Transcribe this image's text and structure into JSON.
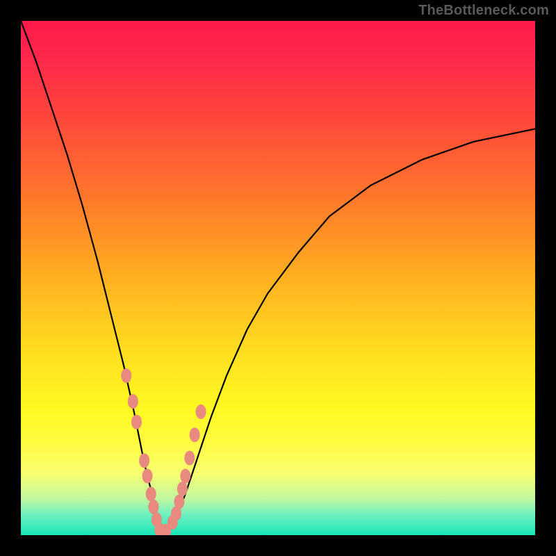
{
  "watermark": {
    "text": "TheBottleneck.com"
  },
  "chart_data": {
    "type": "line",
    "title": "",
    "xlabel": "",
    "ylabel": "",
    "xlim": [
      0,
      100
    ],
    "ylim": [
      0,
      100
    ],
    "grid": false,
    "legend": false,
    "background": {
      "gradient_stops": [
        {
          "pos": 0,
          "color": "#ff1a4d"
        },
        {
          "pos": 0.5,
          "color": "#ffe020"
        },
        {
          "pos": 1,
          "color": "#18e5b8"
        }
      ]
    },
    "series": [
      {
        "name": "bottleneck-curve",
        "color": "#000000",
        "x": [
          0,
          3,
          6,
          9,
          12,
          15,
          18,
          20,
          22,
          24,
          26,
          27,
          28,
          30,
          32,
          34,
          37,
          40,
          44,
          48,
          54,
          60,
          68,
          78,
          88,
          100
        ],
        "y": [
          100,
          92,
          83,
          74,
          64,
          53,
          41,
          33,
          24,
          14,
          6,
          1,
          0.3,
          3,
          8,
          14,
          23,
          31,
          40,
          47,
          55,
          62,
          68,
          73,
          76.5,
          79
        ]
      }
    ],
    "markers": [
      {
        "name": "left-cluster",
        "color": "#e98a80",
        "x": [
          20.5,
          21.8,
          22.5,
          24.0,
          24.6,
          25.3,
          25.8,
          26.4
        ],
        "y": [
          31.0,
          26.0,
          22.0,
          14.5,
          11.5,
          8.0,
          5.5,
          3.0
        ]
      },
      {
        "name": "valley-cluster",
        "color": "#e98a80",
        "x": [
          27.0,
          27.6,
          28.2
        ],
        "y": [
          1.0,
          0.5,
          0.8
        ]
      },
      {
        "name": "right-cluster",
        "color": "#e98a80",
        "x": [
          29.5,
          30.2,
          30.8,
          31.4,
          32.0,
          32.8,
          33.8,
          35.0
        ],
        "y": [
          2.5,
          4.2,
          6.5,
          9.0,
          11.5,
          15.0,
          19.5,
          24.0
        ]
      }
    ]
  },
  "colors": {
    "frame": "#000000",
    "curve": "#000000",
    "marker_fill": "#e98a80",
    "watermark": "#5a5a5a"
  }
}
